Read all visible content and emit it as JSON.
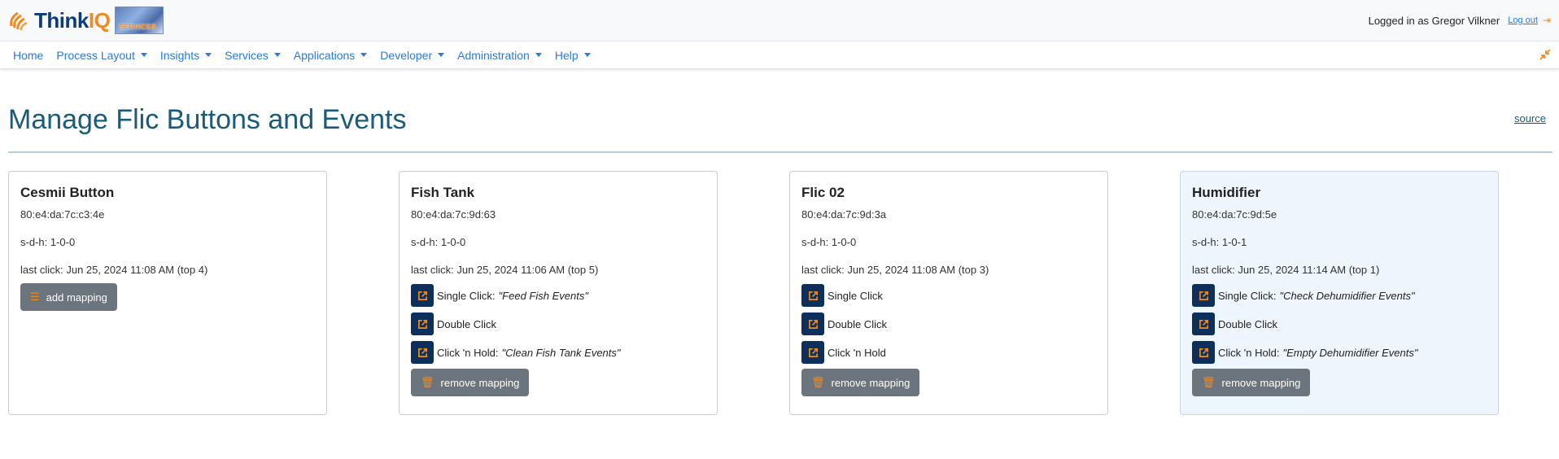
{
  "header": {
    "logo_text_main": "Think",
    "logo_text_accent": "IQ",
    "badge_text": "SERVICES",
    "logged_in_text": "Logged in as Gregor Vilkner",
    "logout_label": "Log out"
  },
  "nav": {
    "items": [
      {
        "label": "Home",
        "dropdown": false
      },
      {
        "label": "Process Layout",
        "dropdown": true
      },
      {
        "label": "Insights",
        "dropdown": true
      },
      {
        "label": "Services",
        "dropdown": true
      },
      {
        "label": "Applications",
        "dropdown": true
      },
      {
        "label": "Developer",
        "dropdown": true
      },
      {
        "label": "Administration",
        "dropdown": true
      },
      {
        "label": "Help",
        "dropdown": true
      }
    ]
  },
  "page": {
    "title": "Manage Flic Buttons and Events",
    "source_label": "source"
  },
  "cards": [
    {
      "name": "Cesmii Button",
      "mac": "80:e4:da:7c:c3:4e",
      "sdh": "s-d-h: 1-0-0",
      "last_click": "last click: Jun 25, 2024 11:08 AM (top 4)",
      "highlight": false,
      "action_label": "add mapping",
      "mappings": []
    },
    {
      "name": "Fish Tank",
      "mac": "80:e4:da:7c:9d:63",
      "sdh": "s-d-h: 1-0-0",
      "last_click": "last click: Jun 25, 2024 11:06 AM (top 5)",
      "highlight": false,
      "action_label": "remove mapping",
      "mappings": [
        {
          "trigger": "Single Click",
          "separator": " :",
          "event": "\"Feed Fish Events\""
        },
        {
          "trigger": "Double Click",
          "separator": "",
          "event": ""
        },
        {
          "trigger": "Click 'n Hold",
          "separator": " :",
          "event": "\"Clean Fish Tank Events\""
        }
      ]
    },
    {
      "name": "Flic 02",
      "mac": "80:e4:da:7c:9d:3a",
      "sdh": "s-d-h: 1-0-0",
      "last_click": "last click: Jun 25, 2024 11:08 AM (top 3)",
      "highlight": false,
      "action_label": "remove mapping",
      "mappings": [
        {
          "trigger": "Single Click",
          "separator": "",
          "event": ""
        },
        {
          "trigger": "Double Click",
          "separator": "",
          "event": ""
        },
        {
          "trigger": "Click 'n Hold",
          "separator": "",
          "event": ""
        }
      ]
    },
    {
      "name": "Humidifier",
      "mac": "80:e4:da:7c:9d:5e",
      "sdh": "s-d-h: 1-0-1",
      "last_click": "last click: Jun 25, 2024 11:14 AM (top 1)",
      "highlight": true,
      "action_label": "remove mapping",
      "mappings": [
        {
          "trigger": "Single Click",
          "separator": " :",
          "event": "\"Check Dehumidifier Events\""
        },
        {
          "trigger": "Double Click",
          "separator": "",
          "event": ""
        },
        {
          "trigger": "Click 'n Hold",
          "separator": " :",
          "event": "\"Empty Dehumidifier Events\""
        }
      ]
    }
  ],
  "colors": {
    "accent": "#f08a1c",
    "link": "#2a7ae2",
    "title": "#1a5b7a",
    "icon_button_bg": "#0c2f5c",
    "gray_button_bg": "#6c757d"
  }
}
